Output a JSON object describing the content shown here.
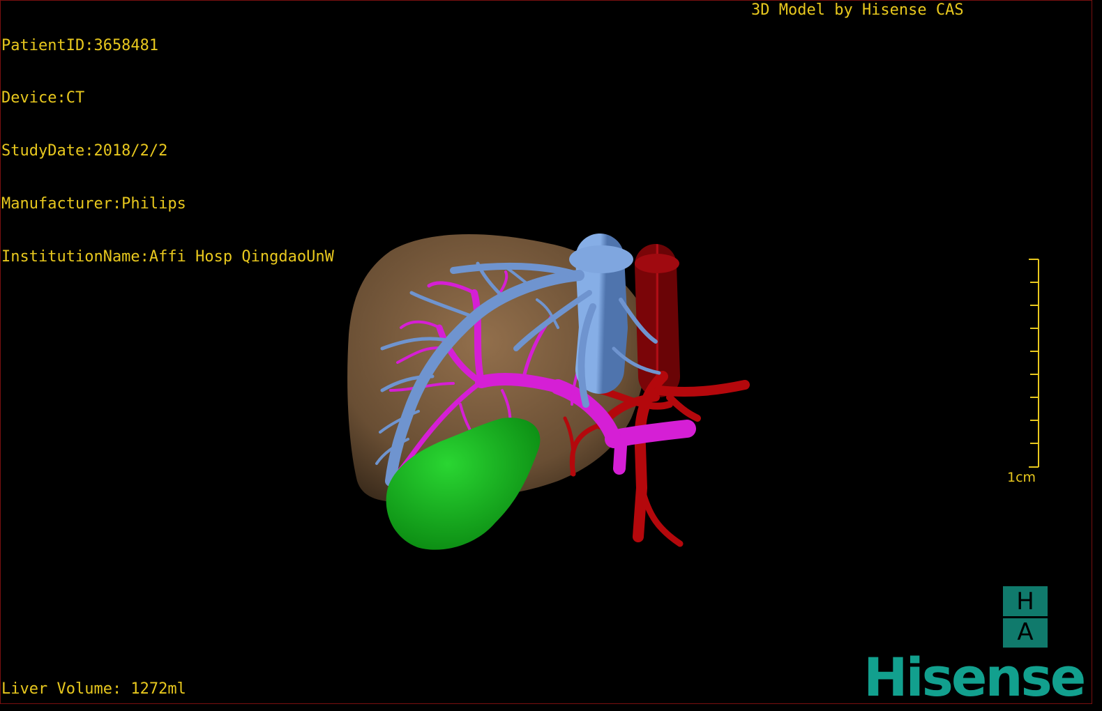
{
  "overlay": {
    "patient_id": "PatientID:3658481",
    "device": "Device:CT",
    "study_date": "StudyDate:2018/2/2",
    "manufacturer": "Manufacturer:Philips",
    "institution": "InstitutionName:Affi Hosp QingdaoUnW",
    "title": "3D Model by Hisense CAS",
    "liver_volume": "Liver Volume: 1272ml"
  },
  "scale_bar": {
    "label": "1cm"
  },
  "orientation": {
    "top": "H",
    "bottom": "A"
  },
  "brand": {
    "logo": "Hisense"
  },
  "model": {
    "parts": [
      "liver-surface",
      "hepatic-vein",
      "portal-vein",
      "artery-vena-cava",
      "gallbladder"
    ]
  },
  "colors": {
    "text": "#e8c81e",
    "liver": "#7a5a3a",
    "hepatic_vein": "#6f94cf",
    "portal_vein": "#d51fd5",
    "artery": "#b4080c",
    "gallbladder": "#13b01c",
    "brand": "#12a08e"
  }
}
